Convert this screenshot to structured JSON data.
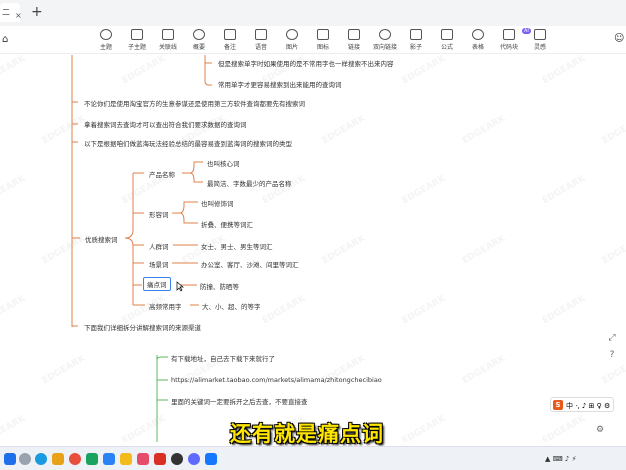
{
  "titlebar": {
    "tab_label": "二",
    "tab_close": "×",
    "add_tab": "+"
  },
  "toolbar": {
    "left_icon": "⌂",
    "items": [
      {
        "label": "主题",
        "icon": "theme-icon"
      },
      {
        "label": "子主题",
        "icon": "subtopic-icon"
      },
      {
        "label": "关联线",
        "icon": "relation-icon"
      },
      {
        "label": "概要",
        "icon": "summary-icon"
      },
      {
        "label": "备注",
        "icon": "note-icon"
      },
      {
        "label": "语音",
        "icon": "voice-icon"
      },
      {
        "label": "图片",
        "icon": "image-icon"
      },
      {
        "label": "图标",
        "icon": "emoji-icon"
      },
      {
        "label": "链接",
        "icon": "link-icon"
      },
      {
        "label": "双向链接",
        "icon": "bilink-icon"
      },
      {
        "label": "影子",
        "icon": "shadow-icon"
      },
      {
        "label": "公式",
        "icon": "formula-icon"
      },
      {
        "label": "表格",
        "icon": "table-icon"
      },
      {
        "label": "代码块",
        "icon": "code-icon"
      },
      {
        "label": "灵感",
        "icon": "ai-icon"
      }
    ],
    "ai_badge": "AI",
    "user_icon": "☺"
  },
  "mindmap": {
    "top_a": "但是搜索单字时如果使用的是不常用字也一样搜索不出来内容",
    "top_b": "常用单字才更容易搜索到出来能用的查询词",
    "branch_1": "不论你们是使用淘宝官方的生意参谋还是使用第三方软件查询都要先有搜索词",
    "branch_2": "拿着搜索词去查询才可以查出符合我们要求数据的查询词",
    "branch_3": "以下是根据咱们做蓝海玩法经验总结的最容易查到蓝海词的搜索词的类型",
    "center": "优质搜索词",
    "cat_product": "产品名称",
    "prod_1": "也叫核心词",
    "prod_2": "最简洁、字数最少的产品名称",
    "cat_adj": "形容词",
    "adj_1": "也叫修饰词",
    "adj_2": "折叠、便携等词汇",
    "cat_people": "人群词",
    "people_1": "女士、男士、男生等词汇",
    "cat_scene": "场景词",
    "scene_1": "办公室、客厅、沙滩、间里等词汇",
    "cat_pain": "痛点词",
    "pain_1": "防撞、防晒等",
    "cat_freq": "高频常用字",
    "freq_1": "大、小、超、的等字",
    "branch_4": "下面我们详细拆分讲解搜索词的来源渠道",
    "green_1": "有下载地址，自己去下载下来就行了",
    "green_2": "https://alimarket.taobao.com/markets/alimama/zhitongchecibiao",
    "green_3": "里面的关键词一定要拆开之后去查，不要直接查"
  },
  "subtitle": "还有就是痛点词",
  "watermark": "EDGEARK",
  "ime": {
    "logo": "S",
    "text": "中 ·, ♪ ⊞ ♀ ⚙"
  },
  "taskbar": {
    "tray": "▲ ⌨ ♪ ⚡"
  },
  "colors": {
    "orange": "#e0804a",
    "green": "#5cb85c",
    "highlight": "#3b82f6",
    "subtitle": "#ffe600"
  }
}
